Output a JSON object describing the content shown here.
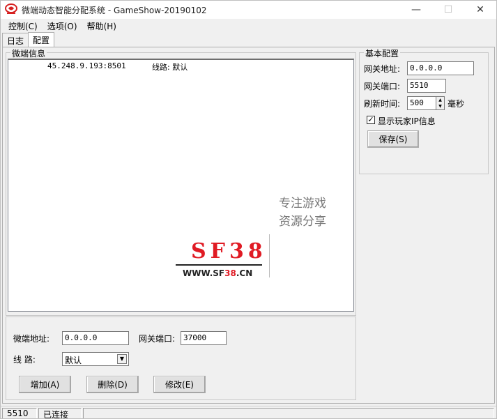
{
  "window": {
    "title": "微端动态智能分配系统 - GameShow-20190102",
    "minimize_glyph": "—",
    "maximize_glyph": "☐",
    "close_glyph": "✕"
  },
  "menu": [
    "控制(C)",
    "选项(O)",
    "帮助(H)"
  ],
  "tabs": [
    "日志",
    "配置"
  ],
  "micro_info": {
    "title": "微端信息",
    "rows": [
      {
        "address": "45.248.9.193:8501",
        "line": "线路: 默认"
      }
    ]
  },
  "basic_config": {
    "title": "基本配置",
    "gateway_address_label": "网关地址:",
    "gateway_address_value": "0.0.0.0",
    "gateway_port_label": "网关端口:",
    "gateway_port_value": "5510",
    "refresh_label": "刷新时间:",
    "refresh_value": "500",
    "refresh_unit": "毫秒",
    "show_ip_label": "显示玩家IP信息",
    "show_ip_checked": true,
    "save_button": "保存(S)"
  },
  "edit_panel": {
    "address_label": "微端地址:",
    "address_value": "0.0.0.0",
    "port_label": "网关端口:",
    "port_value": "37000",
    "line_label": "线    路:",
    "line_value": "默认",
    "add_button": "增加(A)",
    "delete_button": "删除(D)",
    "modify_button": "修改(E)"
  },
  "watermark": {
    "logo": "SF38",
    "url_prefix": "WWW.SF",
    "url_red": "38",
    "url_suffix": ".CN",
    "slogan_1": "专注游戏",
    "slogan_2": "资源分享"
  },
  "status": {
    "port": "5510",
    "connection": "已连接"
  }
}
